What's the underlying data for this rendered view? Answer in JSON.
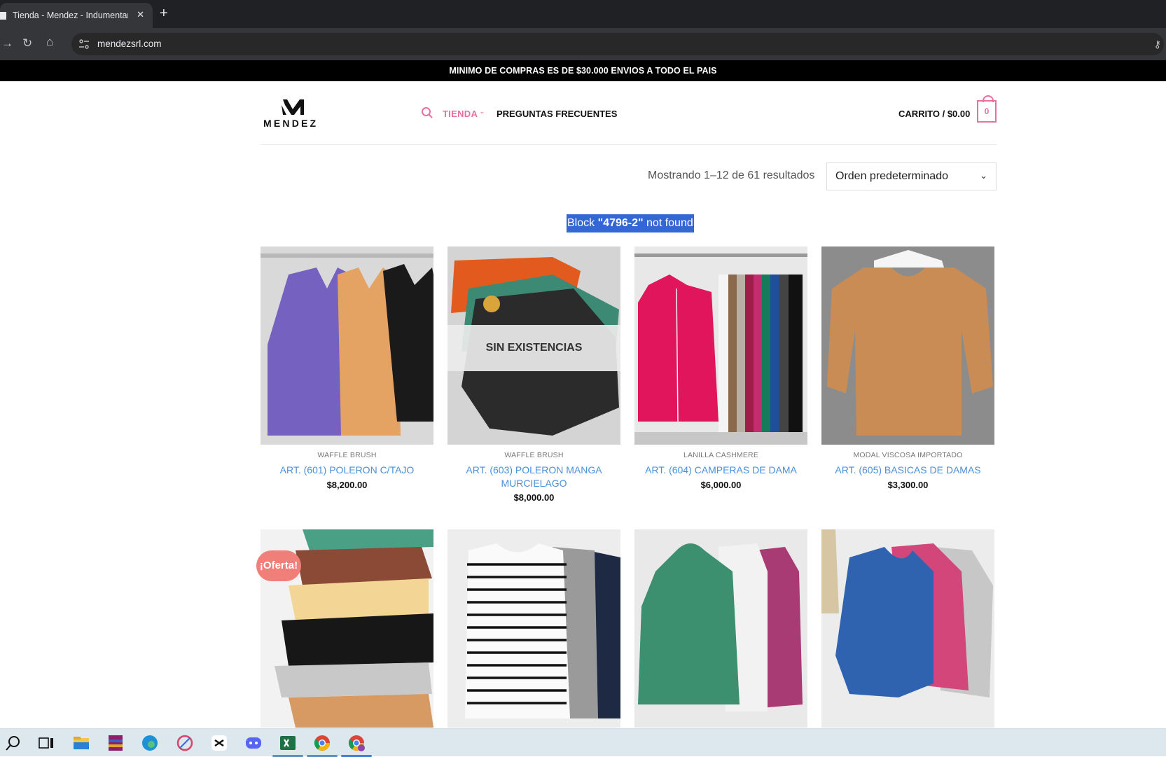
{
  "browser": {
    "tab_title": "Tienda - Mendez - Indumentaria",
    "tab_close": "✕",
    "new_tab": "+",
    "url": "mendezsrl.com"
  },
  "promo_bar": "MINIMO DE COMPRAS ES DE $30.000 ENVIOS A TODO EL PAIS",
  "header": {
    "logo_text": "MENDEZ",
    "nav": [
      {
        "label": "TIENDA"
      },
      {
        "label": "PREGUNTAS FRECUENTES"
      }
    ],
    "cart_label": "CARRITO / $0.00",
    "cart_count": "0"
  },
  "shop": {
    "results_text": "Mostrando 1–12 de 61 resultados",
    "sort_selected": "Orden predeterminado",
    "block_prefix": "Block ",
    "block_id": "\"4796-2\"",
    "block_suffix": " not found"
  },
  "products": [
    {
      "category": "WAFFLE BRUSH",
      "title": "ART. (601) POLERON C/TAJO",
      "price": "$8,200.00"
    },
    {
      "category": "WAFFLE BRUSH",
      "title": "ART. (603) POLERON MANGA MURCIELAGO",
      "price": "$8,000.00",
      "badge": "SIN EXISTENCIAS"
    },
    {
      "category": "LANILLA CASHMERE",
      "title": "ART. (604) CAMPERAS DE DAMA",
      "price": "$6,000.00"
    },
    {
      "category": "MODAL VISCOSA IMPORTADO",
      "title": "ART. (605) BASICAS DE DAMAS",
      "price": "$3,300.00"
    }
  ],
  "sale_badge": "¡Oferta!",
  "colors": {
    "accent_pink": "#e8709e",
    "link_blue": "#4a90d9",
    "sale_badge": "#f07f7a",
    "selection_blue": "#3367d6"
  },
  "taskbar_icons": [
    "search-icon",
    "task-view-icon",
    "file-explorer-icon",
    "winrar-icon",
    "edge-icon",
    "snipping-icon",
    "capcut-icon",
    "discord-icon",
    "excel-icon",
    "chrome-icon",
    "chrome-profile-icon"
  ]
}
